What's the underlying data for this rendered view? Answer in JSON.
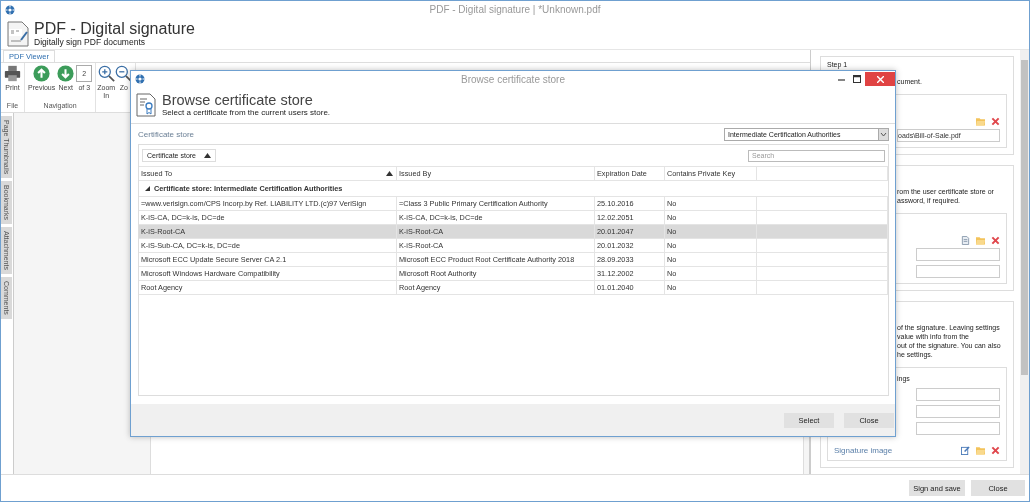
{
  "window": {
    "title": "PDF - Digital signature | *Unknown.pdf"
  },
  "header": {
    "title": "PDF - Digital signature",
    "subtitle": "Digitally sign PDF documents"
  },
  "ribbon_tabs": [
    {
      "label": "PDF Viewer",
      "selected": true
    }
  ],
  "ribbon_groups": [
    {
      "label": "File",
      "items": [
        {
          "kind": "print",
          "label": "Print"
        }
      ]
    },
    {
      "label": "Navigation",
      "items": [
        {
          "kind": "previous",
          "label": "Previous"
        },
        {
          "kind": "next",
          "label": "Next"
        },
        {
          "kind": "page",
          "value": "2",
          "label": "of 3"
        }
      ]
    },
    {
      "items": [
        {
          "kind": "zoom_in",
          "label": "Zoom In"
        },
        {
          "kind": "zoom_out",
          "label": "Zo"
        }
      ]
    }
  ],
  "side_tabs": [
    "Page Thumbnails",
    "Bookmarks",
    "Attachments",
    "Comments"
  ],
  "right_panel": {
    "sections": [
      {
        "items": [
          {
            "kind": "heading",
            "text": "Step 1"
          },
          {
            "kind": "text",
            "text": "cument."
          },
          {
            "kind": "group",
            "items": [
              {
                "kind": "actions",
                "actions": [
                  {
                    "kind": "open"
                  },
                  {
                    "kind": "remove"
                  }
                ]
              },
              {
                "kind": "field",
                "value": "oads\\Bill-of-Sale.pdf"
              }
            ]
          }
        ]
      },
      {
        "items": [
          {
            "kind": "text",
            "text": "rom the user certificate store or"
          },
          {
            "kind": "text",
            "text": "assword, if required."
          },
          {
            "kind": "group",
            "items": [
              {
                "kind": "actions",
                "actions": [
                  {
                    "kind": "new"
                  },
                  {
                    "kind": "open"
                  },
                  {
                    "kind": "remove"
                  }
                ]
              },
              {
                "kind": "field"
              },
              {
                "kind": "field"
              }
            ]
          }
        ]
      },
      {
        "items": [
          {
            "kind": "text",
            "text": "of the signature. Leaving settings"
          },
          {
            "kind": "text",
            "text": "value with info from the"
          },
          {
            "kind": "text",
            "text": "out of the signature. You can also"
          },
          {
            "kind": "text",
            "text": "he settings."
          },
          {
            "kind": "group",
            "items": [
              {
                "kind": "text",
                "text": "ings"
              },
              {
                "kind": "field"
              },
              {
                "kind": "field"
              },
              {
                "kind": "field"
              },
              {
                "kind": "link",
                "text": "Signature image",
                "actions": [
                  {
                    "kind": "edit"
                  },
                  {
                    "kind": "open"
                  },
                  {
                    "kind": "remove"
                  }
                ]
              }
            ]
          }
        ]
      }
    ]
  },
  "dialog": {
    "title": "Browse certificate store",
    "header_title": "Browse certificate store",
    "header_subtitle": "Select a certificate from the current users store.",
    "store_label": "Certificate store",
    "store_value": "Intermediate Certification Authorities",
    "group_button": "Certificate store",
    "search_placeholder": "Search",
    "columns": [
      {
        "label": "Issued To",
        "sorted": true
      },
      {
        "label": "Issued By",
        "sorted": false
      },
      {
        "label": "Expiration Date",
        "sorted": false
      },
      {
        "label": "Contains Private Key",
        "sorted": false
      }
    ],
    "group_row": {
      "label": "Certificate store: Intermediate Certification Authorities",
      "expanded": true
    },
    "rows": [
      {
        "issued_to": "=www.verisign.com/CPS Incorp.by Ref. LIABILITY LTD.(c)97 VeriSign",
        "issued_by": "=Class 3 Public Primary Certification Authority",
        "expiration": "25.10.2016",
        "private_key": "No",
        "selected": false
      },
      {
        "issued_to": "K-iS-CA, DC=k-is, DC=de",
        "issued_by": "K-iS-CA, DC=k-is, DC=de",
        "expiration": "12.02.2051",
        "private_key": "No",
        "selected": false
      },
      {
        "issued_to": "K-iS-Root-CA",
        "issued_by": "K-iS-Root-CA",
        "expiration": "20.01.2047",
        "private_key": "No",
        "selected": true
      },
      {
        "issued_to": "K-iS-Sub-CA, DC=k-is, DC=de",
        "issued_by": "K-iS-Root-CA",
        "expiration": "20.01.2032",
        "private_key": "No",
        "selected": false
      },
      {
        "issued_to": "Microsoft ECC Update Secure Server CA 2.1",
        "issued_by": "Microsoft ECC Product Root Certificate Authority 2018",
        "expiration": "28.09.2033",
        "private_key": "No",
        "selected": false
      },
      {
        "issued_to": "Microsoft Windows Hardware Compatibility",
        "issued_by": "Microsoft Root Authority",
        "expiration": "31.12.2002",
        "private_key": "No",
        "selected": false
      },
      {
        "issued_to": "Root Agency",
        "issued_by": "Root Agency",
        "expiration": "01.01.2040",
        "private_key": "No",
        "selected": false
      }
    ],
    "buttons": [
      "Select",
      "Close"
    ]
  },
  "footer_buttons": [
    "Sign and save",
    "Close"
  ]
}
